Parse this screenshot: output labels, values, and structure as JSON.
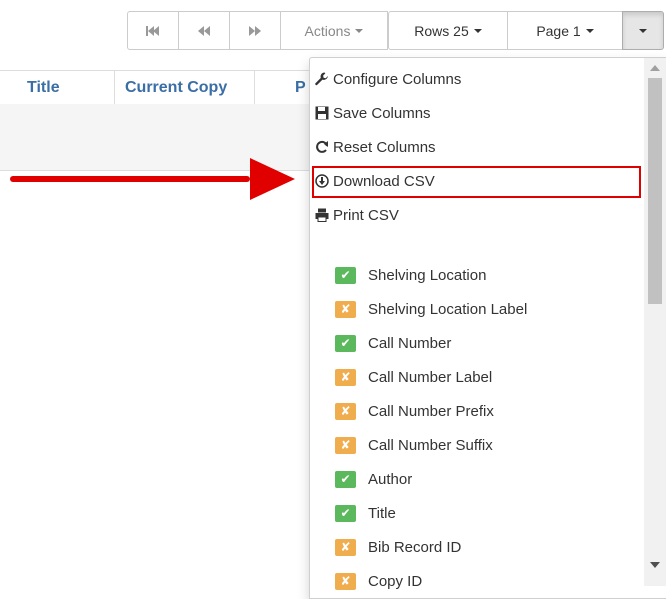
{
  "toolbar": {
    "first_icon": "first-page-icon",
    "prev_icon": "previous-page-icon",
    "next_icon": "next-page-icon",
    "actions_label": "Actions",
    "rows_label": "Rows 25",
    "page_label": "Page 1",
    "menu_toggle_icon": "caret-down-icon"
  },
  "grid": {
    "columns": [
      "Title",
      "Current Copy",
      "P"
    ]
  },
  "menu": {
    "actions": [
      {
        "label": "Configure Columns",
        "icon": "wrench-icon"
      },
      {
        "label": "Save Columns",
        "icon": "save-icon"
      },
      {
        "label": "Reset Columns",
        "icon": "refresh-icon"
      },
      {
        "label": "Download CSV",
        "icon": "download-icon"
      },
      {
        "label": "Print CSV",
        "icon": "print-icon"
      }
    ],
    "columns": [
      {
        "label": "Shelving Location",
        "visible": true
      },
      {
        "label": "Shelving Location Label",
        "visible": false
      },
      {
        "label": "Call Number",
        "visible": true
      },
      {
        "label": "Call Number Label",
        "visible": false
      },
      {
        "label": "Call Number Prefix",
        "visible": false
      },
      {
        "label": "Call Number Suffix",
        "visible": false
      },
      {
        "label": "Author",
        "visible": true
      },
      {
        "label": "Title",
        "visible": true
      },
      {
        "label": "Bib Record ID",
        "visible": false
      },
      {
        "label": "Copy ID",
        "visible": false
      }
    ]
  },
  "colors": {
    "highlight": "#e00000",
    "arrow": "#e00000",
    "check_on": "#5cb85c",
    "check_off": "#f0ad4e",
    "header_text": "#3a6ea5"
  }
}
